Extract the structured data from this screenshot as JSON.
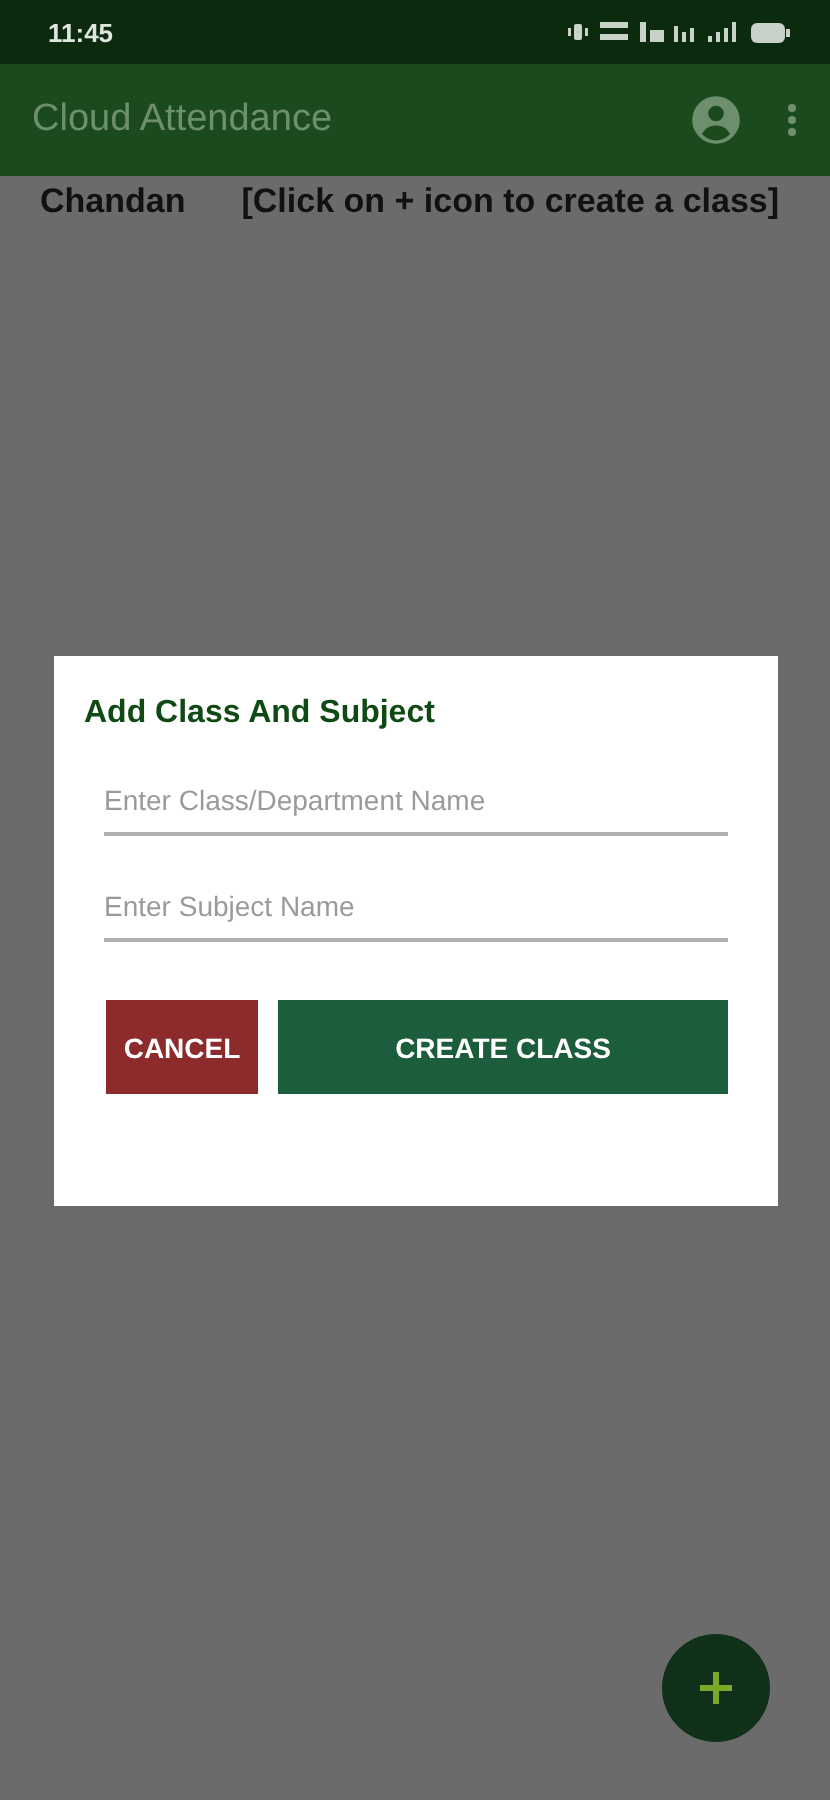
{
  "status_bar": {
    "time": "11:45"
  },
  "app_bar": {
    "title": "Cloud Attendance"
  },
  "header": {
    "user": "Chandan",
    "hint": "[Click on + icon to create a class]"
  },
  "dialog": {
    "title": "Add Class And Subject",
    "fields": [
      {
        "placeholder": "Enter Class/Department Name"
      },
      {
        "placeholder": "Enter Subject Name"
      }
    ],
    "buttons": [
      {
        "label": "CANCEL",
        "kind": "cancel"
      },
      {
        "label": "CREATE CLASS",
        "kind": "confirm"
      }
    ]
  }
}
